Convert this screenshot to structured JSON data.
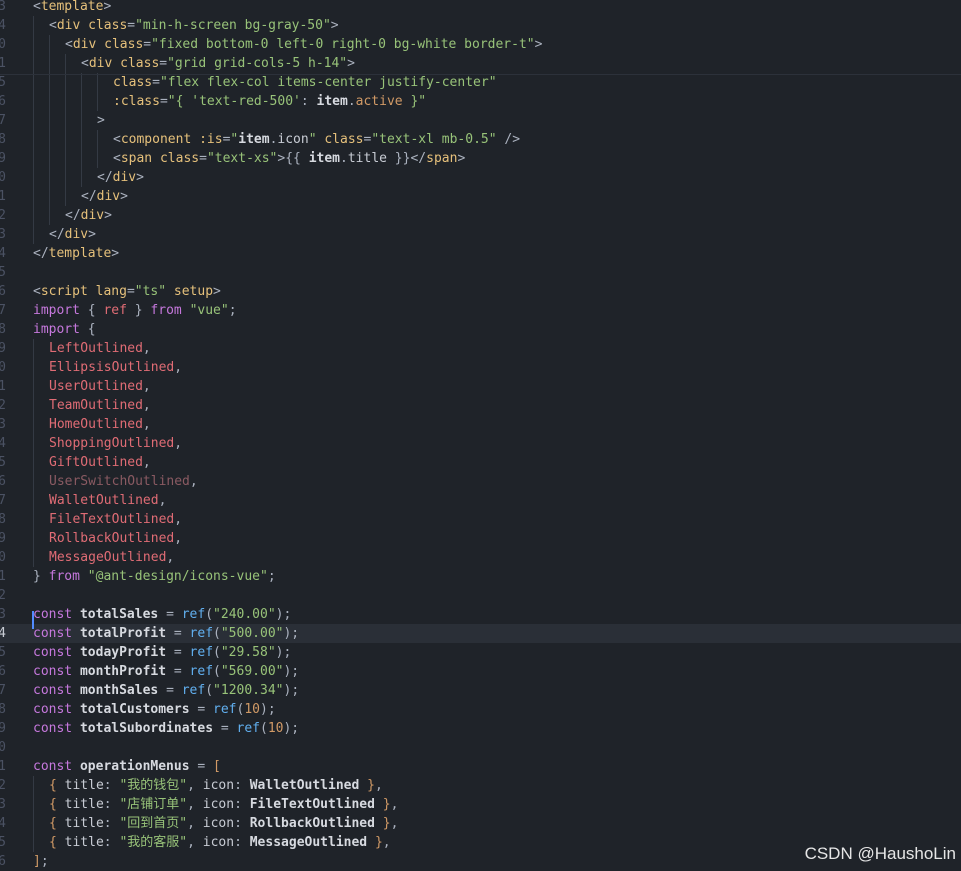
{
  "editor": {
    "current_line_index": 33,
    "lines": [
      {
        "no": "3",
        "tokens": [
          [
            "brk",
            "<"
          ],
          [
            "tag",
            "template"
          ],
          [
            "brk",
            ">"
          ]
        ]
      },
      {
        "no": "4",
        "indent": 1,
        "tokens": [
          [
            "brk",
            "<"
          ],
          [
            "tag",
            "div "
          ],
          [
            "attr",
            "class"
          ],
          [
            "punc",
            "="
          ],
          [
            "str",
            "\"min-h-screen bg-gray-50\""
          ],
          [
            "brk",
            ">"
          ]
        ]
      },
      {
        "no": "0",
        "indent": 2,
        "tokens": [
          [
            "brk",
            "<"
          ],
          [
            "tag",
            "div "
          ],
          [
            "attr",
            "class"
          ],
          [
            "punc",
            "="
          ],
          [
            "str",
            "\"fixed bottom-0 left-0 right-0 bg-white border-t\""
          ],
          [
            "brk",
            ">"
          ]
        ]
      },
      {
        "no": "1",
        "indent": 3,
        "tokens": [
          [
            "brk",
            "<"
          ],
          [
            "tag",
            "div "
          ],
          [
            "attr",
            "class"
          ],
          [
            "punc",
            "="
          ],
          [
            "str",
            "\"grid grid-cols-5 h-14\""
          ],
          [
            "brk",
            ">"
          ]
        ]
      },
      {
        "no": "5",
        "indent": 5,
        "tokens": [
          [
            "attr",
            "class"
          ],
          [
            "punc",
            "="
          ],
          [
            "str",
            "\"flex flex-col items-center justify-center\""
          ]
        ]
      },
      {
        "no": "6",
        "indent": 5,
        "tokens": [
          [
            "attr",
            ":class"
          ],
          [
            "punc",
            "="
          ],
          [
            "str",
            "\"{ "
          ],
          [
            "str",
            "'text-red-500'"
          ],
          [
            "punc",
            ": "
          ],
          [
            "bold",
            "item"
          ],
          [
            "punc",
            "."
          ],
          [
            "orange",
            "active"
          ],
          [
            "str",
            " }\""
          ]
        ]
      },
      {
        "no": "7",
        "indent": 4,
        "tokens": [
          [
            "brk",
            ">"
          ]
        ]
      },
      {
        "no": "8",
        "indent": 5,
        "tokens": [
          [
            "brk",
            "<"
          ],
          [
            "tag",
            "component "
          ],
          [
            "attr",
            ":is"
          ],
          [
            "punc",
            "="
          ],
          [
            "str",
            "\""
          ],
          [
            "bold",
            "item"
          ],
          [
            "punc",
            "."
          ],
          [
            "txt",
            "icon"
          ],
          [
            "str",
            "\" "
          ],
          [
            "attr",
            "class"
          ],
          [
            "punc",
            "="
          ],
          [
            "str",
            "\"text-xl mb-0.5\""
          ],
          [
            "brk",
            " />"
          ]
        ]
      },
      {
        "no": "9",
        "indent": 5,
        "tokens": [
          [
            "brk",
            "<"
          ],
          [
            "tag",
            "span "
          ],
          [
            "attr",
            "class"
          ],
          [
            "punc",
            "="
          ],
          [
            "str",
            "\"text-xs\""
          ],
          [
            "brk",
            ">"
          ],
          [
            "punc",
            "{{ "
          ],
          [
            "bold",
            "item"
          ],
          [
            "punc",
            "."
          ],
          [
            "txt",
            "title"
          ],
          [
            "punc",
            " }}"
          ],
          [
            "brk",
            "</"
          ],
          [
            "tag",
            "span"
          ],
          [
            "brk",
            ">"
          ]
        ]
      },
      {
        "no": "0",
        "indent": 4,
        "tokens": [
          [
            "brk",
            "</"
          ],
          [
            "tag",
            "div"
          ],
          [
            "brk",
            ">"
          ]
        ]
      },
      {
        "no": "1",
        "indent": 3,
        "tokens": [
          [
            "brk",
            "</"
          ],
          [
            "tag",
            "div"
          ],
          [
            "brk",
            ">"
          ]
        ]
      },
      {
        "no": "2",
        "indent": 2,
        "tokens": [
          [
            "brk",
            "</"
          ],
          [
            "tag",
            "div"
          ],
          [
            "brk",
            ">"
          ]
        ]
      },
      {
        "no": "3",
        "indent": 1,
        "tokens": [
          [
            "brk",
            "</"
          ],
          [
            "tag",
            "div"
          ],
          [
            "brk",
            ">"
          ]
        ]
      },
      {
        "no": "4",
        "tokens": [
          [
            "brk",
            "</"
          ],
          [
            "tag",
            "template"
          ],
          [
            "brk",
            ">"
          ]
        ]
      },
      {
        "no": "5",
        "tokens": []
      },
      {
        "no": "6",
        "tokens": [
          [
            "brk",
            "<"
          ],
          [
            "tag",
            "script "
          ],
          [
            "attr",
            "lang"
          ],
          [
            "punc",
            "="
          ],
          [
            "str",
            "\"ts\" "
          ],
          [
            "attr",
            "setup"
          ],
          [
            "brk",
            ">"
          ]
        ]
      },
      {
        "no": "7",
        "tokens": [
          [
            "kw",
            "import "
          ],
          [
            "punc",
            "{ "
          ],
          [
            "id",
            "ref"
          ],
          [
            "punc",
            " } "
          ],
          [
            "kw",
            "from "
          ],
          [
            "str",
            "\"vue\""
          ],
          [
            "punc",
            ";"
          ]
        ]
      },
      {
        "no": "8",
        "tokens": [
          [
            "kw",
            "import "
          ],
          [
            "punc",
            "{"
          ]
        ]
      },
      {
        "no": "9",
        "indent": 1,
        "tokens": [
          [
            "id",
            "LeftOutlined"
          ],
          [
            "punc",
            ","
          ]
        ]
      },
      {
        "no": "0",
        "indent": 1,
        "tokens": [
          [
            "id",
            "EllipsisOutlined"
          ],
          [
            "punc",
            ","
          ]
        ]
      },
      {
        "no": "1",
        "indent": 1,
        "tokens": [
          [
            "id",
            "UserOutlined"
          ],
          [
            "punc",
            ","
          ]
        ]
      },
      {
        "no": "2",
        "indent": 1,
        "tokens": [
          [
            "id",
            "TeamOutlined"
          ],
          [
            "punc",
            ","
          ]
        ]
      },
      {
        "no": "3",
        "indent": 1,
        "tokens": [
          [
            "id",
            "HomeOutlined"
          ],
          [
            "punc",
            ","
          ]
        ]
      },
      {
        "no": "4",
        "indent": 1,
        "tokens": [
          [
            "id",
            "ShoppingOutlined"
          ],
          [
            "punc",
            ","
          ]
        ]
      },
      {
        "no": "5",
        "indent": 1,
        "tokens": [
          [
            "id",
            "GiftOutlined"
          ],
          [
            "punc",
            ","
          ]
        ]
      },
      {
        "no": "6",
        "indent": 1,
        "tokens": [
          [
            "dim",
            "UserSwitchOutlined"
          ],
          [
            "punc",
            ","
          ]
        ]
      },
      {
        "no": "7",
        "indent": 1,
        "tokens": [
          [
            "id",
            "WalletOutlined"
          ],
          [
            "punc",
            ","
          ]
        ]
      },
      {
        "no": "8",
        "indent": 1,
        "tokens": [
          [
            "id",
            "FileTextOutlined"
          ],
          [
            "punc",
            ","
          ]
        ]
      },
      {
        "no": "9",
        "indent": 1,
        "tokens": [
          [
            "id",
            "RollbackOutlined"
          ],
          [
            "punc",
            ","
          ]
        ]
      },
      {
        "no": "0",
        "indent": 1,
        "tokens": [
          [
            "id",
            "MessageOutlined"
          ],
          [
            "punc",
            ","
          ]
        ]
      },
      {
        "no": "1",
        "tokens": [
          [
            "punc",
            "} "
          ],
          [
            "kw",
            "from "
          ],
          [
            "str",
            "\"@ant-design/icons-vue\""
          ],
          [
            "punc",
            ";"
          ]
        ]
      },
      {
        "no": "2",
        "tokens": []
      },
      {
        "no": "3",
        "tokens": [
          [
            "kw",
            "const "
          ],
          [
            "bold",
            "totalSales"
          ],
          [
            "punc",
            " = "
          ],
          [
            "fn",
            "ref"
          ],
          [
            "punc",
            "("
          ],
          [
            "str",
            "\"240.00\""
          ],
          [
            "punc",
            ");"
          ]
        ]
      },
      {
        "no": "4",
        "tokens": [
          [
            "kw",
            "const "
          ],
          [
            "bold",
            "totalProfit"
          ],
          [
            "punc",
            " = "
          ],
          [
            "fn",
            "ref"
          ],
          [
            "punc",
            "("
          ],
          [
            "str",
            "\"500.00\""
          ],
          [
            "punc",
            ");"
          ]
        ]
      },
      {
        "no": "5",
        "tokens": [
          [
            "kw",
            "const "
          ],
          [
            "bold",
            "todayProfit"
          ],
          [
            "punc",
            " = "
          ],
          [
            "fn",
            "ref"
          ],
          [
            "punc",
            "("
          ],
          [
            "str",
            "\"29.58\""
          ],
          [
            "punc",
            ");"
          ]
        ]
      },
      {
        "no": "6",
        "tokens": [
          [
            "kw",
            "const "
          ],
          [
            "bold",
            "monthProfit"
          ],
          [
            "punc",
            " = "
          ],
          [
            "fn",
            "ref"
          ],
          [
            "punc",
            "("
          ],
          [
            "str",
            "\"569.00\""
          ],
          [
            "punc",
            ");"
          ]
        ]
      },
      {
        "no": "7",
        "tokens": [
          [
            "kw",
            "const "
          ],
          [
            "bold",
            "monthSales"
          ],
          [
            "punc",
            " = "
          ],
          [
            "fn",
            "ref"
          ],
          [
            "punc",
            "("
          ],
          [
            "str",
            "\"1200.34\""
          ],
          [
            "punc",
            ");"
          ]
        ]
      },
      {
        "no": "8",
        "tokens": [
          [
            "kw",
            "const "
          ],
          [
            "bold",
            "totalCustomers"
          ],
          [
            "punc",
            " = "
          ],
          [
            "fn",
            "ref"
          ],
          [
            "punc",
            "("
          ],
          [
            "num",
            "10"
          ],
          [
            "punc",
            ");"
          ]
        ]
      },
      {
        "no": "9",
        "tokens": [
          [
            "kw",
            "const "
          ],
          [
            "bold",
            "totalSubordinates"
          ],
          [
            "punc",
            " = "
          ],
          [
            "fn",
            "ref"
          ],
          [
            "punc",
            "("
          ],
          [
            "num",
            "10"
          ],
          [
            "punc",
            ");"
          ]
        ]
      },
      {
        "no": "0",
        "tokens": []
      },
      {
        "no": "1",
        "tokens": [
          [
            "kw",
            "const "
          ],
          [
            "bold",
            "operationMenus"
          ],
          [
            "punc",
            " = "
          ],
          [
            "orange",
            "["
          ]
        ]
      },
      {
        "no": "2",
        "indent": 1,
        "tokens": [
          [
            "orange",
            "{ "
          ],
          [
            "txt",
            "title"
          ],
          [
            "punc",
            ": "
          ],
          [
            "str",
            "\"我的钱包\""
          ],
          [
            "punc",
            ", "
          ],
          [
            "txt",
            "icon"
          ],
          [
            "punc",
            ": "
          ],
          [
            "bold",
            "WalletOutlined"
          ],
          [
            "orange",
            " }"
          ],
          [
            "punc",
            ","
          ]
        ]
      },
      {
        "no": "3",
        "indent": 1,
        "tokens": [
          [
            "orange",
            "{ "
          ],
          [
            "txt",
            "title"
          ],
          [
            "punc",
            ": "
          ],
          [
            "str",
            "\"店铺订单\""
          ],
          [
            "punc",
            ", "
          ],
          [
            "txt",
            "icon"
          ],
          [
            "punc",
            ": "
          ],
          [
            "bold",
            "FileTextOutlined"
          ],
          [
            "orange",
            " }"
          ],
          [
            "punc",
            ","
          ]
        ]
      },
      {
        "no": "4",
        "indent": 1,
        "tokens": [
          [
            "orange",
            "{ "
          ],
          [
            "txt",
            "title"
          ],
          [
            "punc",
            ": "
          ],
          [
            "str",
            "\"回到首页\""
          ],
          [
            "punc",
            ", "
          ],
          [
            "txt",
            "icon"
          ],
          [
            "punc",
            ": "
          ],
          [
            "bold",
            "RollbackOutlined"
          ],
          [
            "orange",
            " }"
          ],
          [
            "punc",
            ","
          ]
        ]
      },
      {
        "no": "5",
        "indent": 1,
        "tokens": [
          [
            "orange",
            "{ "
          ],
          [
            "txt",
            "title"
          ],
          [
            "punc",
            ": "
          ],
          [
            "str",
            "\"我的客服\""
          ],
          [
            "punc",
            ", "
          ],
          [
            "txt",
            "icon"
          ],
          [
            "punc",
            ": "
          ],
          [
            "bold",
            "MessageOutlined"
          ],
          [
            "orange",
            " }"
          ],
          [
            "punc",
            ","
          ]
        ]
      },
      {
        "no": "6",
        "tokens": [
          [
            "orange",
            "]"
          ],
          [
            "punc",
            ";"
          ]
        ]
      }
    ]
  },
  "watermark": "CSDN @HaushoLin",
  "colors": {
    "background": "#1f2329",
    "current_line": "#2a2f37",
    "cursor": "#528bff"
  }
}
